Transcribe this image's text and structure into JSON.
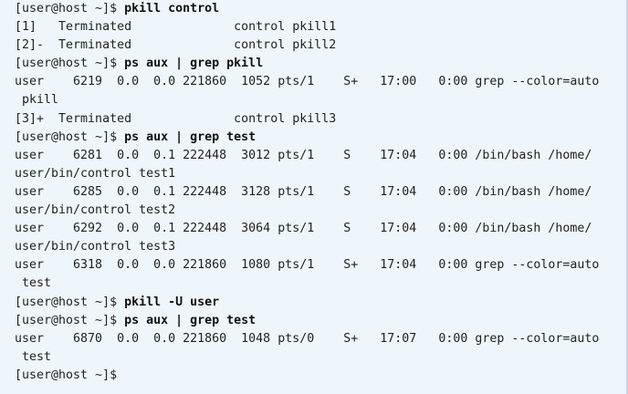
{
  "terminal": {
    "lines": [
      {
        "type": "cmd",
        "prompt": "[user@host ~]$ ",
        "command": "pkill control"
      },
      {
        "type": "out",
        "text": "[1]   Terminated              control pkill1"
      },
      {
        "type": "out",
        "text": "[2]-  Terminated              control pkill2"
      },
      {
        "type": "cmd",
        "prompt": "[user@host ~]$ ",
        "command": "ps aux | grep pkill"
      },
      {
        "type": "out",
        "text": "user    6219  0.0  0.0 221860  1052 pts/1    S+   17:00   0:00 grep --color=auto"
      },
      {
        "type": "out",
        "text": " pkill"
      },
      {
        "type": "out",
        "text": "[3]+  Terminated              control pkill3"
      },
      {
        "type": "cmd",
        "prompt": "[user@host ~]$ ",
        "command": "ps aux | grep test"
      },
      {
        "type": "out",
        "text": "user    6281  0.0  0.1 222448  3012 pts/1    S    17:04   0:00 /bin/bash /home/"
      },
      {
        "type": "out",
        "text": "user/bin/control test1"
      },
      {
        "type": "out",
        "text": "user    6285  0.0  0.1 222448  3128 pts/1    S    17:04   0:00 /bin/bash /home/"
      },
      {
        "type": "out",
        "text": "user/bin/control test2"
      },
      {
        "type": "out",
        "text": "user    6292  0.0  0.1 222448  3064 pts/1    S    17:04   0:00 /bin/bash /home/"
      },
      {
        "type": "out",
        "text": "user/bin/control test3"
      },
      {
        "type": "out",
        "text": "user    6318  0.0  0.0 221860  1080 pts/1    S+   17:04   0:00 grep --color=auto"
      },
      {
        "type": "out",
        "text": " test"
      },
      {
        "type": "cmd",
        "prompt": "[user@host ~]$ ",
        "command": "pkill -U user"
      },
      {
        "type": "cmd",
        "prompt": "[user@host ~]$ ",
        "command": "ps aux | grep test"
      },
      {
        "type": "out",
        "text": "user    6870  0.0  0.0 221860  1048 pts/0    S+   17:07   0:00 grep --color=auto"
      },
      {
        "type": "out",
        "text": " test"
      },
      {
        "type": "cmd",
        "prompt": "[user@host ~]$",
        "command": ""
      }
    ]
  }
}
